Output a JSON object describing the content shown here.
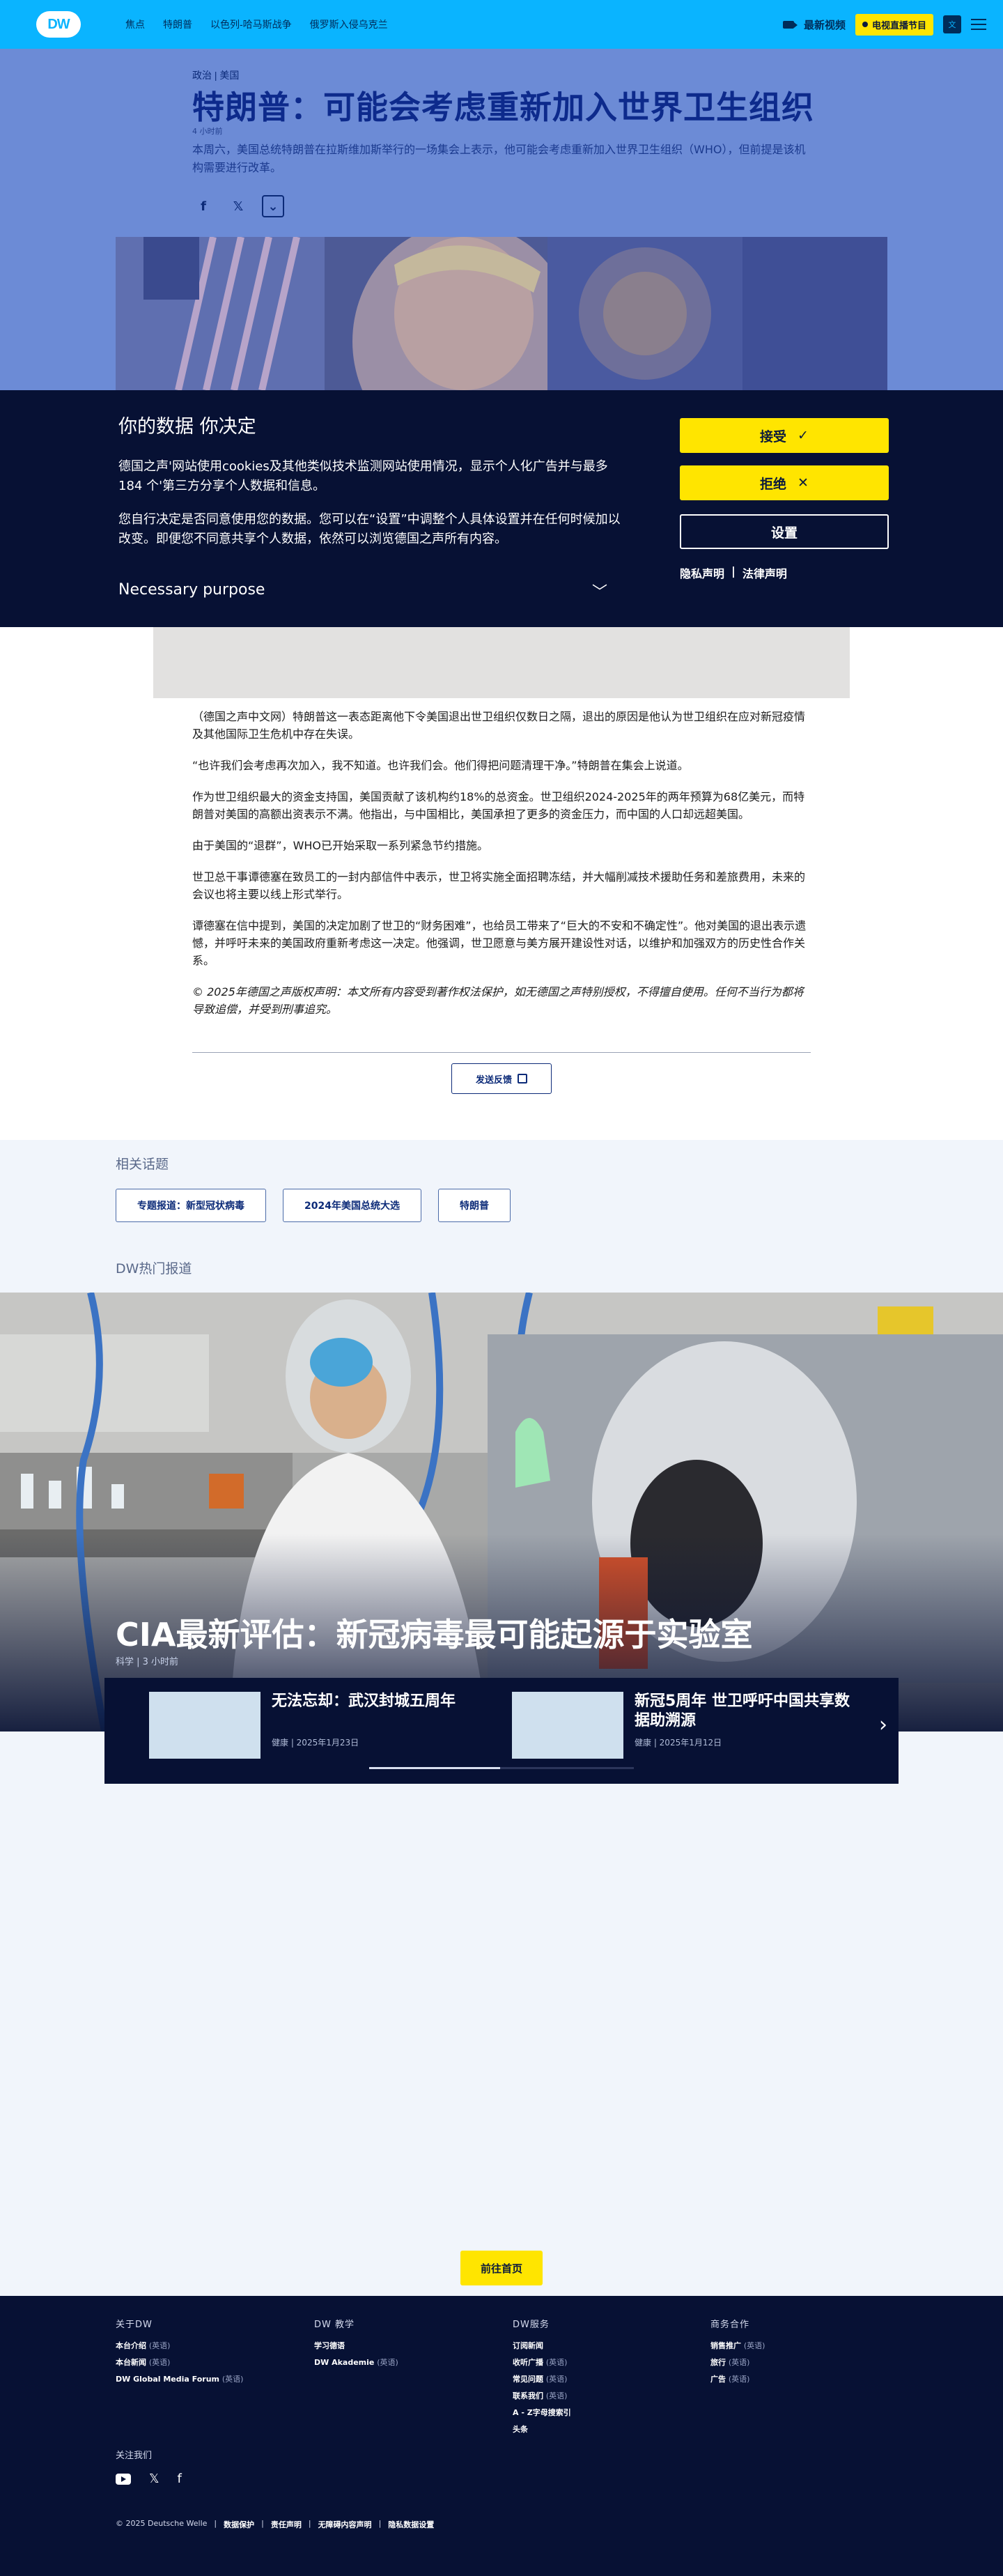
{
  "header": {
    "logo": "DW",
    "nav": [
      "焦点",
      "特朗普",
      "以色列-哈马斯战争",
      "俄罗斯入侵乌克兰"
    ],
    "latest_video": "最新视频",
    "live_tv": "电视直播节目",
    "lang": "文"
  },
  "article": {
    "kicker": "政治 | 美国",
    "title": "特朗普：可能会考虑重新加入世界卫生组织",
    "time": "4 小时前",
    "lead": "本周六，美国总统特朗普在拉斯维加斯举行的一场集会上表示，他可能会考虑重新加入世界卫生组织（WHO），但前提是该机构需要进行改革。",
    "share": {
      "facebook": "f",
      "x": "𝕏",
      "more": "⌄"
    },
    "paragraphs": [
      "（德国之声中文网）特朗普这一表态距离他下令美国退出世卫组织仅数日之隔，退出的原因是他认为世卫组织在应对新冠疫情及其他国际卫生危机中存在失误。",
      "“也许我们会考虑再次加入，我不知道。也许我们会。他们得把问题清理干净。”特朗普在集会上说道。",
      "作为世卫组织最大的资金支持国，美国贡献了该机构约18%的总资金。世卫组织2024-2025年的两年预算为68亿美元，而特朗普对美国的高额出资表示不满。他指出，与中国相比，美国承担了更多的资金压力，而中国的人口却远超美国。",
      "由于美国的“退群”，WHO已开始采取一系列紧急节约措施。",
      "世卫总干事谭德塞在致员工的一封内部信件中表示，世卫将实施全面招聘冻结，并大幅削减技术援助任务和差旅费用，未来的会议也将主要以线上形式举行。",
      "谭德塞在信中提到，美国的决定加剧了世卫的“财务困难”，也给员工带来了“巨大的不安和不确定性”。他对美国的退出表示遗憾，并呼吁未来的美国政府重新考虑这一决定。他强调，世卫愿意与美方展开建设性对话，以维护和加强双方的历史性合作关系。"
    ],
    "copyright": "© 2025年德国之声版权声明：本文所有内容受到著作权法保护，如无德国之声特别授权，不得擅自使用。任何不当行为都将导致追偿，并受到刑事追究。",
    "feedback": "发送反馈"
  },
  "cookie": {
    "title": "你的数据 你决定",
    "p1": "德国之声'网站使用cookies及其他类似技术监测网站使用情况，显示个人化广告并与最多184 个'第三方分享个人数据和信息。",
    "p2": "您自行决定是否同意使用您的数据。您可以在“设置”中调整个人具体设置并在任何时候加以改变。即便您不同意共享个人数据，依然可以浏览德国之声所有内容。",
    "purpose": "Necessary purpose",
    "accept": "接受",
    "accept_icon": "✓",
    "reject": "拒绝",
    "reject_icon": "✕",
    "settings": "设置",
    "privacy": "隐私声明",
    "legal": "法律声明"
  },
  "related": {
    "title": "相关话题",
    "topics": [
      "专题报道：新型冠状病毒",
      "2024年美国总统大选",
      "特朗普"
    ]
  },
  "hot": {
    "title": "DW热门报道",
    "headline": "CIA最新评估：新冠病毒最可能起源于实验室",
    "meta": "科学 | 3 小时前",
    "teasers": [
      {
        "title": "无法忘却：武汉封城五周年",
        "meta": "健康 | 2025年1月23日"
      },
      {
        "title": "新冠5周年 世卫呼吁中国共享数据助溯源",
        "meta": "健康 | 2025年1月12日"
      }
    ],
    "next": "›"
  },
  "home_button": "前往首页",
  "footer": {
    "cols": [
      {
        "title": "关于DW",
        "links": [
          {
            "label": "本台介绍",
            "tag": "(英语)"
          },
          {
            "label": "本台新闻",
            "tag": "(英语)"
          },
          {
            "label": "DW Global Media Forum",
            "tag": "(英语)"
          }
        ]
      },
      {
        "title": "DW 教学",
        "links": [
          {
            "label": "学习德语",
            "tag": ""
          },
          {
            "label": "DW Akademie",
            "tag": "(英语)"
          }
        ]
      },
      {
        "title": "DW服务",
        "links": [
          {
            "label": "订阅新闻",
            "tag": ""
          },
          {
            "label": "收听广播",
            "tag": "(英语)"
          },
          {
            "label": "常见问题",
            "tag": "(英语)"
          },
          {
            "label": "联系我们",
            "tag": "(英语)"
          },
          {
            "label": "A - Z字母搜索引",
            "tag": ""
          },
          {
            "label": "头条",
            "tag": ""
          }
        ]
      },
      {
        "title": "商务合作",
        "links": [
          {
            "label": "销售推广",
            "tag": "(英语)"
          },
          {
            "label": "旅行",
            "tag": "(英语)"
          },
          {
            "label": "广告",
            "tag": "(英语)"
          }
        ]
      }
    ],
    "follow": "关注我们",
    "copyright": "© 2025 Deutsche Welle",
    "legal_links": [
      "数据保护",
      "责任声明",
      "无障碍内容声明",
      "隐私数据设置"
    ]
  }
}
